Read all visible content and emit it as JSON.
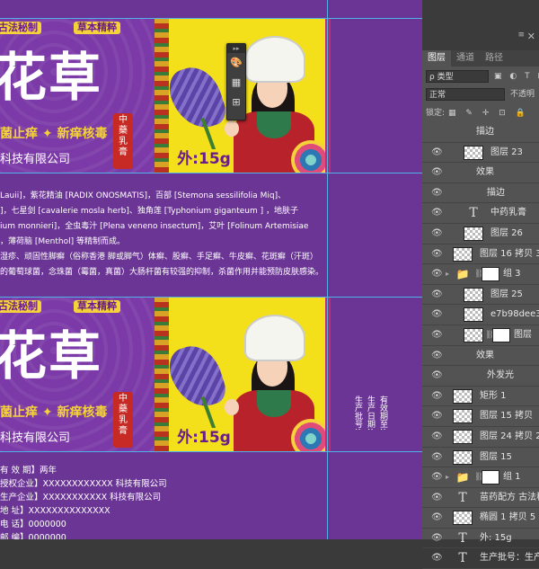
{
  "label": {
    "tags": [
      "古法秘制",
      "草本精粹"
    ],
    "big_text": "花草",
    "slogan": "菌止痒 ✦ 新痒核毒",
    "company": "科技有限公司",
    "seal_chars": [
      "中",
      "藥",
      "乳",
      "膏"
    ],
    "weight": "外:15g"
  },
  "ingredients": [
    "Lauii]，紫花精油 [RADIX ONOSMATIS]，百部 [Stemona sessilifolia Miq]、",
    "]，七星剑 [cavalerie mosla herb]、独角莲 [Typhonium giganteum ] ，地肤子",
    "ium monnieri]，全虫毒汁 [Plena veneno insectum]，艾叶 [Folinum Artemisiae",
    "，薄荷脑 [Menthol] 等精制而成。",
    "湿疹、顽固性脚癣（俗称香港 脚或脚气）体癣、股癣、手足癣、牛皮癣、花斑癣（汗斑）",
    "的葡萄球菌，念珠菌（霉菌，真菌）大肠杆菌有较强的抑制，杀菌作用并能预防皮肤感染。"
  ],
  "info_rows": [
    "有 效 期】两年",
    "授权企业】XXXXXXXXXXXX 科技有限公司",
    "生产企业】XXXXXXXXXXX 科技有限公司",
    "地    址】XXXXXXXXXXXXXX",
    "电    话】0000000",
    "邮    编】0000000"
  ],
  "vertical_labels": [
    "生产批号:",
    "生产日期:",
    "有效期至:"
  ],
  "mini_toolbar": {
    "collapse": "▸▸",
    "tools": [
      "🎨",
      "▦",
      "⊞"
    ]
  },
  "panel": {
    "window_close": "✕",
    "menu_dots": "≡",
    "tabs": [
      "图层",
      "通道",
      "路径"
    ],
    "active_tab": 0,
    "kind_label": "ρ 类型",
    "filter_icons": "▣ ◐ T ⊡ ⊕",
    "blend_mode": "正常",
    "opacity_label": "不透明",
    "lock_label": "锁定:",
    "lock_icons": "▦ ✎ ✛ ⊡ 🔒",
    "layers": [
      {
        "name": "描边",
        "indent": 2,
        "type": "effect",
        "eye": false
      },
      {
        "name": "图层 23",
        "indent": 1,
        "type": "checker",
        "eye": true
      },
      {
        "name": "效果",
        "indent": 2,
        "type": "effect",
        "eye": true
      },
      {
        "name": "描边",
        "indent": 3,
        "type": "effect",
        "eye": true
      },
      {
        "name": "中药乳膏",
        "indent": 1,
        "type": "text",
        "eye": true
      },
      {
        "name": "图层 26",
        "indent": 1,
        "type": "checker",
        "eye": true
      },
      {
        "name": "图层 16 拷贝 3",
        "indent": 0,
        "type": "checker",
        "eye": true
      },
      {
        "name": "组 3",
        "indent": 0,
        "type": "group",
        "eye": true
      },
      {
        "name": "图层 25",
        "indent": 1,
        "type": "checker",
        "eye": true
      },
      {
        "name": "e7b98dee3ac8",
        "indent": 1,
        "type": "checker",
        "eye": true
      },
      {
        "name": "图层",
        "indent": 1,
        "type": "masked",
        "eye": true
      },
      {
        "name": "效果",
        "indent": 2,
        "type": "effect",
        "eye": true
      },
      {
        "name": "外发光",
        "indent": 3,
        "type": "effect",
        "eye": true
      },
      {
        "name": "矩形 1",
        "indent": 0,
        "type": "shape",
        "eye": true
      },
      {
        "name": "图层 15 拷贝",
        "indent": 0,
        "type": "checker",
        "eye": true
      },
      {
        "name": "图层 24 拷贝 2",
        "indent": 0,
        "type": "checker",
        "eye": true
      },
      {
        "name": "图层 15",
        "indent": 0,
        "type": "checker",
        "eye": true
      },
      {
        "name": "组 1",
        "indent": 0,
        "type": "group",
        "eye": true
      },
      {
        "name": "苗药配方 古法秘",
        "indent": 0,
        "type": "text",
        "eye": true
      },
      {
        "name": "椭圆 1 拷贝 5",
        "indent": 0,
        "type": "shape",
        "eye": true
      },
      {
        "name": "外: 15g",
        "indent": 0,
        "type": "text",
        "eye": true
      },
      {
        "name": "生产批号：生产",
        "indent": 0,
        "type": "text",
        "eye": true
      }
    ]
  }
}
